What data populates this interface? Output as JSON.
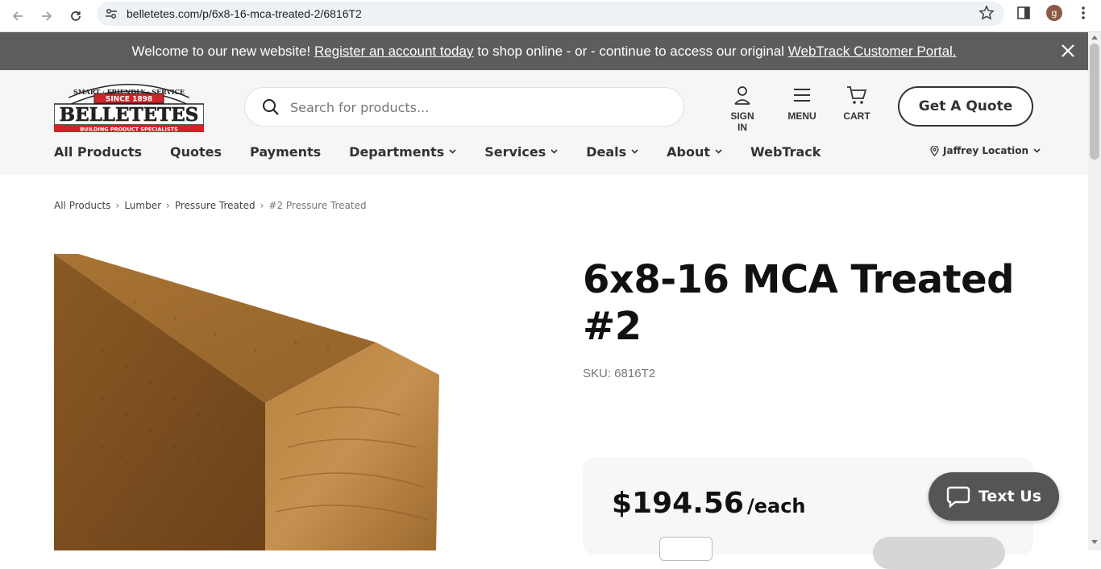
{
  "browser": {
    "url": "belletetes.com/p/6x8-16-mca-treated-2/6816T2",
    "avatar_letter": "g"
  },
  "announcement": {
    "text_1": "Welcome to our new website!",
    "link_register": "Register an account today",
    "text_2": "to shop online - or - continue to access our original",
    "link_webtrack": "WebTrack Customer Portal."
  },
  "header": {
    "logo": {
      "tagline": "SMART · FRIENDLY · SERVICE",
      "since": "SINCE 1898",
      "name": "BELLETETES",
      "subtitle": "BUILDING PRODUCT SPECIALISTS"
    },
    "search_placeholder": "Search for products...",
    "sign_in_label": "SIGN IN",
    "menu_label": "MENU",
    "cart_label": "CART",
    "quote_button": "Get A Quote",
    "nav": [
      {
        "label": "All Products",
        "dropdown": false
      },
      {
        "label": "Quotes",
        "dropdown": false
      },
      {
        "label": "Payments",
        "dropdown": false
      },
      {
        "label": "Departments",
        "dropdown": true
      },
      {
        "label": "Services",
        "dropdown": true
      },
      {
        "label": "Deals",
        "dropdown": true
      },
      {
        "label": "About",
        "dropdown": true
      },
      {
        "label": "WebTrack",
        "dropdown": false
      }
    ],
    "location": "Jaffrey Location"
  },
  "breadcrumb": [
    "All Products",
    "Lumber",
    "Pressure Treated",
    "#2 Pressure Treated"
  ],
  "product": {
    "title_line1": "6x8-16 MCA Treated",
    "title_line2": "#2",
    "sku": "SKU: 6816T2",
    "price": "$194.56",
    "unit": "/each"
  },
  "chat": {
    "label": "Text Us"
  },
  "colors": {
    "announce_bg": "#5d5d5d",
    "header_bg": "#f6f6f6",
    "logo_red": "#d2232a",
    "chat_bg": "#555555"
  }
}
